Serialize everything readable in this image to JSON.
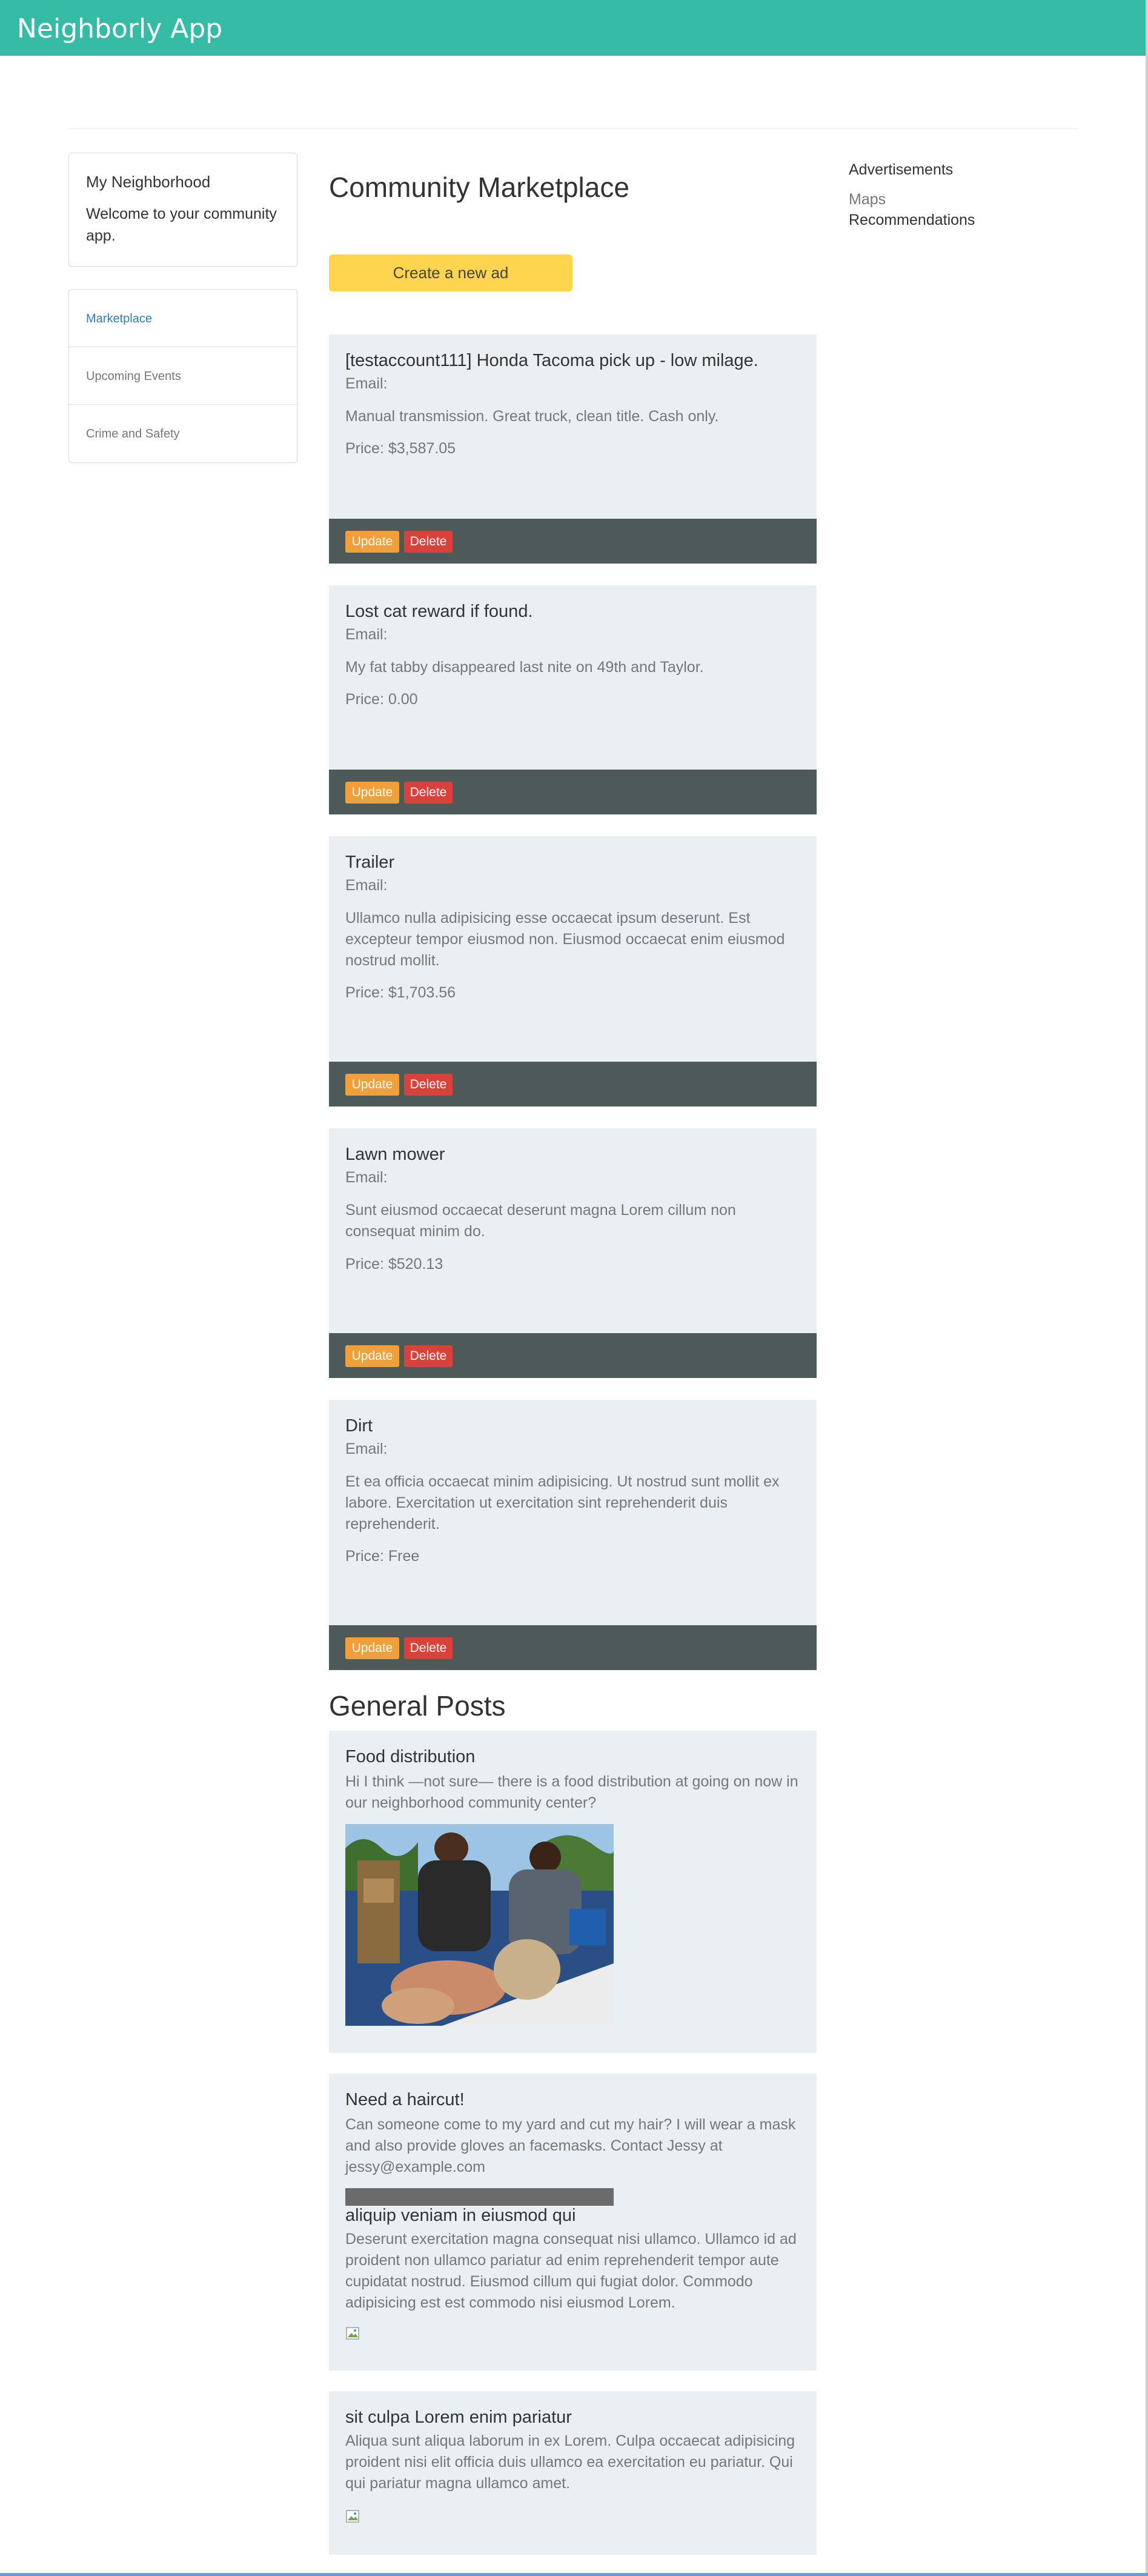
{
  "app": {
    "brand": "Neighborly App"
  },
  "sidebar": {
    "welcome_title": "My Neighborhood",
    "welcome_text": "Welcome to your community app.",
    "nav": [
      {
        "label": "Marketplace",
        "active": true
      },
      {
        "label": "Upcoming Events",
        "active": false
      },
      {
        "label": "Crime and Safety",
        "active": false
      }
    ]
  },
  "main": {
    "title": "Community Marketplace",
    "create_button": "Create a new ad",
    "update_label": "Update",
    "delete_label": "Delete",
    "ads": [
      {
        "title": "[testaccount111] Honda Tacoma pick up - low milage.",
        "email": "Email:",
        "description": "Manual transmission. Great truck, clean title. Cash only.",
        "price": "Price: $3,587.05"
      },
      {
        "title": "Lost cat reward if found.",
        "email": "Email:",
        "description": "My fat tabby disappeared last nite on 49th and Taylor.",
        "price": "Price: 0.00"
      },
      {
        "title": "Trailer",
        "email": "Email:",
        "description": "Ullamco nulla adipisicing esse occaecat ipsum deserunt. Est excepteur tempor eiusmod non. Eiusmod occaecat enim eiusmod nostrud mollit.",
        "price": "Price: $1,703.56"
      },
      {
        "title": "Lawn mower",
        "email": "Email:",
        "description": "Sunt eiusmod occaecat deserunt magna Lorem cillum non consequat minim do.",
        "price": "Price: $520.13"
      },
      {
        "title": "Dirt",
        "email": "Email:",
        "description": "Et ea officia occaecat minim adipisicing. Ut nostrud sunt mollit ex labore. Exercitation ut exercitation sint reprehenderit duis reprehenderit.",
        "price": "Price: Free"
      }
    ],
    "posts_title": "General Posts",
    "posts": [
      {
        "title": "Food distribution",
        "text": "Hi I think —not sure— there is a food distribution at going on now in our neighborhood community center?"
      },
      {
        "title": "Need a haircut!",
        "text": "Can someone come to my yard and cut my hair? I will wear a mask and also provide gloves an facemasks. Contact Jessy at jessy@example.com",
        "sub_title": "aliquip veniam in eiusmod qui",
        "sub_text": "Deserunt exercitation magna consequat nisi ullamco. Ullamco id ad proident non ullamco pariatur ad enim reprehenderit tempor aute cupidatat nostrud. Eiusmod cillum qui fugiat dolor. Commodo adipisicing est est commodo nisi eiusmod Lorem."
      },
      {
        "title": "sit culpa Lorem enim pariatur",
        "text": "Aliqua sunt aliqua laborum in ex Lorem. Culpa occaecat adipisicing proident nisi elit officia duis ullamco ea exercitation eu pariatur. Qui qui pariatur magna ullamco amet."
      }
    ]
  },
  "right": {
    "heading": "Advertisements",
    "links": [
      "Maps",
      "Recommendations"
    ]
  },
  "colors": {
    "navbar": "#36bba6",
    "create_button": "#ffd54f",
    "card_bg": "#e9eff3",
    "card_footer": "#4e5a5a",
    "update_button": "#f0a03a",
    "delete_button": "#d9413a",
    "active_link": "#337ab7"
  }
}
